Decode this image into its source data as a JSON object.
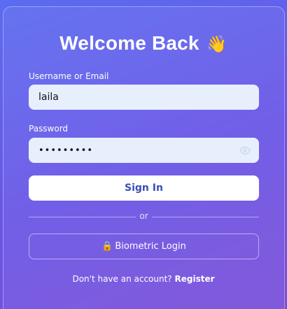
{
  "form": {
    "title": "Welcome Back",
    "title_emoji": "👋",
    "username_label": "Username or Email",
    "username_value": "laila",
    "password_label": "Password",
    "password_masked": "•••••••••",
    "show_password_icon": "eye-icon",
    "sign_in_label": "Sign In",
    "divider_text": "or",
    "biometric_icon": "🔒",
    "biometric_label": "Biometric Login",
    "footer_text": "Don't have an account?",
    "register_label": "Register"
  },
  "colors": {
    "background_start": "#5b6cf0",
    "background_end": "#7b4fd8",
    "input_background": "#e8effc",
    "primary_button_text": "#3a4fb8"
  }
}
